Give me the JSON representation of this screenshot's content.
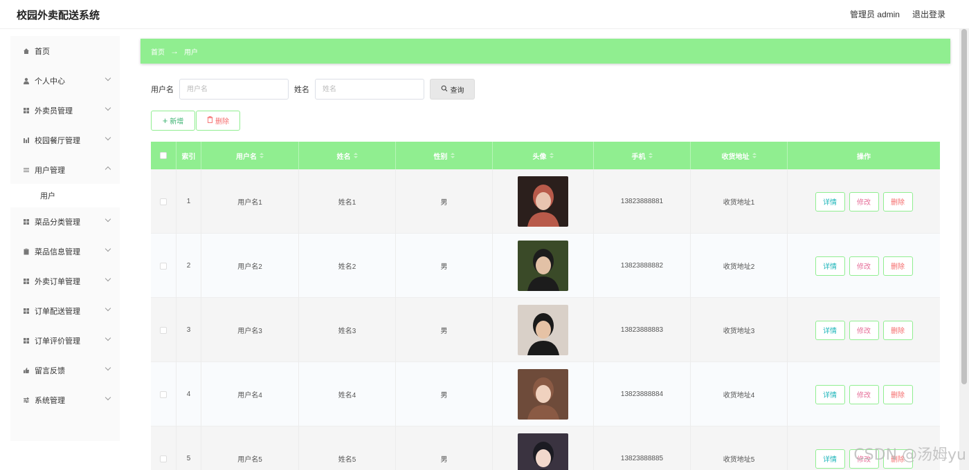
{
  "header": {
    "title": "校园外卖配送系统",
    "user": "管理员 admin",
    "logout": "退出登录"
  },
  "sidebar": {
    "items": [
      {
        "label": "首页",
        "icon": "home-icon"
      },
      {
        "label": "个人中心",
        "icon": "user-icon"
      },
      {
        "label": "外卖员管理",
        "icon": "grid-icon"
      },
      {
        "label": "校园餐厅管理",
        "icon": "chart-icon"
      },
      {
        "label": "用户管理",
        "icon": "list-icon"
      },
      {
        "label": "菜品分类管理",
        "icon": "grid-icon"
      },
      {
        "label": "菜品信息管理",
        "icon": "clipboard-icon"
      },
      {
        "label": "外卖订单管理",
        "icon": "grid-icon"
      },
      {
        "label": "订单配送管理",
        "icon": "grid-icon"
      },
      {
        "label": "订单评价管理",
        "icon": "grid-icon"
      },
      {
        "label": "留言反馈",
        "icon": "thumb-icon"
      },
      {
        "label": "系统管理",
        "icon": "sliders-icon"
      }
    ],
    "submenu": {
      "label": "用户"
    }
  },
  "breadcrumb": {
    "home": "首页",
    "current": "用户"
  },
  "search": {
    "username_label": "用户名",
    "username_placeholder": "用户名",
    "name_label": "姓名",
    "name_placeholder": "姓名",
    "query_label": "查询"
  },
  "actions": {
    "add": "新增",
    "delete": "删除"
  },
  "table": {
    "headers": [
      "索引",
      "用户名",
      "姓名",
      "性别",
      "头像",
      "手机",
      "收货地址",
      "操作"
    ],
    "op_labels": {
      "detail": "详情",
      "edit": "修改",
      "delete": "删除"
    },
    "rows": [
      {
        "index": "1",
        "username": "用户名1",
        "name": "姓名1",
        "gender": "男",
        "phone": "13823888881",
        "address": "收货地址1"
      },
      {
        "index": "2",
        "username": "用户名2",
        "name": "姓名2",
        "gender": "男",
        "phone": "13823888882",
        "address": "收货地址2"
      },
      {
        "index": "3",
        "username": "用户名3",
        "name": "姓名3",
        "gender": "男",
        "phone": "13823888883",
        "address": "收货地址3"
      },
      {
        "index": "4",
        "username": "用户名4",
        "name": "姓名4",
        "gender": "男",
        "phone": "13823888884",
        "address": "收货地址4"
      },
      {
        "index": "5",
        "username": "用户名5",
        "name": "姓名5",
        "gender": "男",
        "phone": "13823888885",
        "address": "收货地址5"
      }
    ]
  },
  "watermark": "CSDN @汤姆yu",
  "colors": {
    "accent": "#90ee90"
  }
}
